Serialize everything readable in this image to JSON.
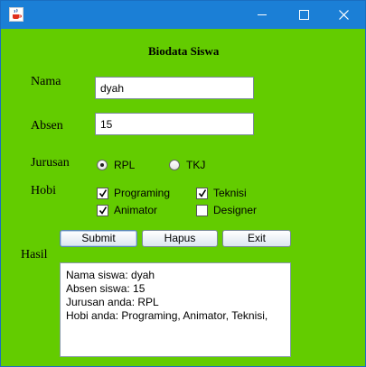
{
  "window": {
    "icon": "java-cup-icon",
    "controls": [
      "minimize-icon",
      "maximize-icon",
      "close-icon"
    ],
    "titlebar_color": "#1b7fd6",
    "background_color": "#63cc00"
  },
  "form": {
    "heading": "Biodata Siswa",
    "nama": {
      "label": "Nama",
      "value": "dyah"
    },
    "absen": {
      "label": "Absen",
      "value": "15"
    },
    "jurusan": {
      "label": "Jurusan",
      "options": [
        {
          "label": "RPL",
          "selected": true
        },
        {
          "label": "TKJ",
          "selected": false
        }
      ]
    },
    "hobi": {
      "label": "Hobi",
      "options": [
        {
          "label": "Programing",
          "checked": true
        },
        {
          "label": "Teknisi",
          "checked": true
        },
        {
          "label": "Animator",
          "checked": true
        },
        {
          "label": "Designer",
          "checked": false
        }
      ]
    },
    "buttons": {
      "submit": "Submit",
      "hapus": "Hapus",
      "exit": "Exit"
    },
    "hasil": {
      "label": "Hasil",
      "lines": [
        "Nama siswa: dyah",
        "Absen siswa: 15",
        "Jurusan anda: RPL",
        "Hobi anda: Programing, Animator, Teknisi,"
      ]
    }
  }
}
